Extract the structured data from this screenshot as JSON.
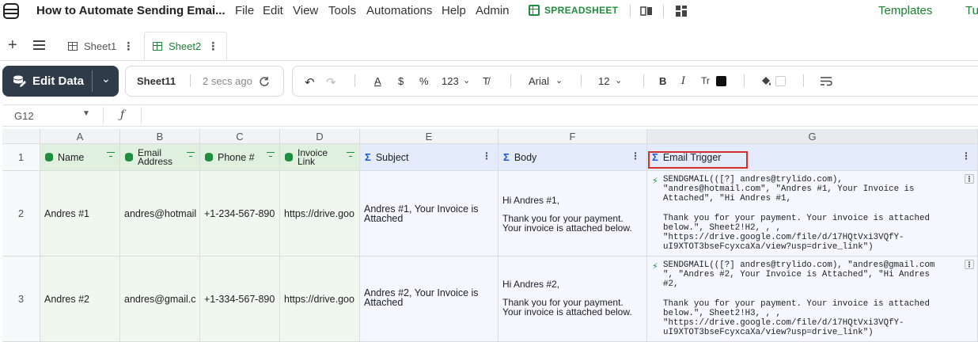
{
  "menubar": {
    "title": "How to Automate Sending Emai...",
    "menus": [
      "File",
      "Edit",
      "View",
      "Tools",
      "Automations",
      "Help",
      "Admin"
    ],
    "badge": "SPREADSHEET",
    "templates": "Templates",
    "tu": "Tu"
  },
  "tabs": {
    "items": [
      "Sheet1",
      "Sheet2"
    ],
    "active": "Sheet2"
  },
  "toolbar": {
    "edit_data": "Edit Data",
    "sheet_name": "Sheet11",
    "saved": "2 secs ago",
    "number_format": "123",
    "font": "Arial",
    "font_size": "12",
    "currency": "$",
    "percent": "%",
    "bold": "B",
    "italic": "I",
    "text_style": "Tr"
  },
  "formula_bar": {
    "cell_ref": "G12",
    "fx": "ƒ"
  },
  "grid": {
    "columns": [
      "A",
      "B",
      "C",
      "D",
      "E",
      "F",
      "G"
    ],
    "rows": [
      "1",
      "2",
      "3"
    ],
    "headers": {
      "a": "Name",
      "b_line1": "Email",
      "b_line2": "Address",
      "c": "Phone #",
      "d_line1": "Invoice",
      "d_line2": "Link",
      "e": "Subject",
      "f": "Body",
      "g": "Email Trigger"
    },
    "row2": {
      "a": "Andres #1",
      "b": "andres@hotmail",
      "c": "+1-234-567-890",
      "d": "https://drive.goo",
      "e": "Andres #1, Your Invoice is Attached",
      "f_line1": "Hi Andres #1,",
      "f_line2": "Thank you for your payment.",
      "f_line3": "Your invoice is attached below.",
      "g": "SENDGMAIL(([?] andres@trylido.com),\n\"andres@hotmail.com\", \"Andres #1, Your Invoice is\nAttached\", \"Hi Andres #1,\n\nThank you for your payment. Your invoice is attached\nbelow.\", Sheet2!H2, , ,\n\"https://drive.google.com/file/d/17HQtVxi3VQfY-\nuI9XTOT3bseFcyxcaXa/view?usp=drive_link\")"
    },
    "row3": {
      "a": "Andres #2",
      "b": "andres@gmail.c",
      "c": "+1-334-567-890",
      "d": "https://drive.goo",
      "e": "Andres #2, Your Invoice is Attached",
      "f_line1": "Hi Andres #2,",
      "f_line2": "Thank you for your payment.",
      "f_line3": "Your invoice is attached below.",
      "g": "SENDGMAIL(([?] andres@trylido.com), \"andres@gmail.com\n\", \"Andres #2, Your Invoice is Attached\", \"Hi Andres\n#2,\n\nThank you for your payment. Your invoice is attached\nbelow.\", Sheet2!H3, , ,\n\"https://drive.google.com/file/d/17HQtVxi3VQfY-\nuI9XTOT3bseFcyxcaXa/view?usp=drive_link\")"
    }
  }
}
